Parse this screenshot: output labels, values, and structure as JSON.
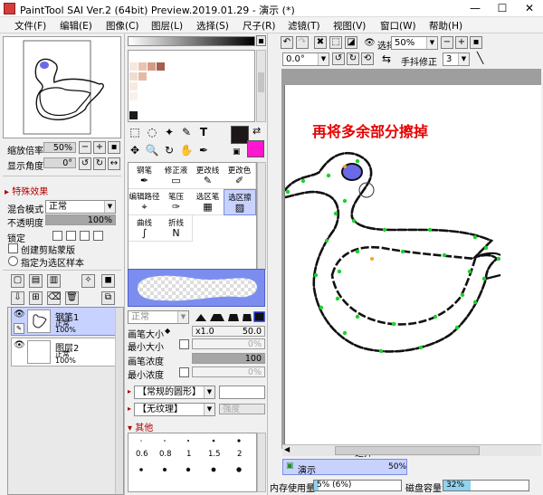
{
  "window": {
    "title": "PaintTool SAI Ver.2 (64bit) Preview.2019.01.29 - 演示 (*)",
    "min": "—",
    "max": "☐",
    "close": "✕"
  },
  "menu": [
    {
      "label": "文件(F)"
    },
    {
      "label": "编辑(E)"
    },
    {
      "label": "图像(C)"
    },
    {
      "label": "图层(L)"
    },
    {
      "label": "选择(S)"
    },
    {
      "label": "尺子(R)"
    },
    {
      "label": "滤镜(T)"
    },
    {
      "label": "视图(V)"
    },
    {
      "label": "窗口(W)"
    },
    {
      "label": "帮助(H)"
    }
  ],
  "navigator": {
    "zoom_label": "缩放倍率",
    "zoom_value": "50%",
    "angle_label": "显示角度",
    "angle_value": "0°"
  },
  "layer_panel": {
    "section_title": "特殊效果",
    "blend_label": "混合模式",
    "blend_value": "正常",
    "opacity_label": "不透明度",
    "opacity_value": "100%",
    "opacity_level": 1.0,
    "lock_label": "锁定",
    "clip_label": "创建剪贴蒙版",
    "sample_label": "指定为选区样本",
    "layers": [
      {
        "name": "钢笔1",
        "mode": "正常",
        "pct": "100%",
        "selected": true
      },
      {
        "name": "图层2",
        "mode": "正常",
        "pct": "100%",
        "selected": false
      }
    ]
  },
  "palette_colors": [
    "#f4e8e0",
    "#e8c4b0",
    "#d49b86",
    "#a45f4b",
    "#f2dcd2",
    "#e6b9a6",
    "#f6ebe4",
    "#f9f1ec",
    "#ffffff",
    "#1b1b1b"
  ],
  "colors": {
    "primary": "#1e1719",
    "secondary": "#ff17d0",
    "selection": "#c8d2ff",
    "stroke_green": "#19d32a"
  },
  "tools": [
    {
      "name": "select-rect-icon",
      "glyph": "⬚"
    },
    {
      "name": "lasso-icon",
      "glyph": "◌"
    },
    {
      "name": "magic-wand-icon",
      "glyph": "✦"
    },
    {
      "name": "pen-select-icon",
      "glyph": "✎"
    },
    {
      "name": "text-icon",
      "glyph": "T"
    },
    {
      "name": "move-icon",
      "glyph": "✥"
    },
    {
      "name": "zoom-icon",
      "glyph": "🔍"
    },
    {
      "name": "rotate-icon",
      "glyph": "↻"
    },
    {
      "name": "hand-icon",
      "glyph": "✋"
    },
    {
      "name": "eyedropper-icon",
      "glyph": "✒"
    }
  ],
  "brushes": [
    {
      "label": "钢笔",
      "icon": "✒"
    },
    {
      "label": "修正液",
      "icon": "▭"
    },
    {
      "label": "更改线",
      "icon": "✎"
    },
    {
      "label": "更改色",
      "icon": "✐"
    },
    {
      "label": "编辑路径",
      "icon": "⌖"
    },
    {
      "label": "笔压",
      "icon": "✑"
    },
    {
      "label": "选区笔",
      "icon": "▦"
    },
    {
      "label": "选区擦",
      "icon": "▨"
    },
    {
      "label": "曲线",
      "icon": "∫"
    },
    {
      "label": "折线",
      "icon": "N"
    }
  ],
  "brush_settings": {
    "mode_value": "正常",
    "size_label": "画笔大小",
    "size_mult": "x1.0",
    "size_value": "50.0",
    "min_size_label": "最小大小",
    "min_size_value": "0%",
    "density_label": "画笔浓度",
    "density_value": "100",
    "min_density_label": "最小浓度",
    "min_density_value": "0%",
    "shape_value": "【常规的圆形】",
    "texture_value": "【无纹理】",
    "texture_strength_label": "强度",
    "other_label": "其他",
    "dot_sizes": [
      "0.6",
      "0.8",
      "1",
      "1.5",
      "2"
    ]
  },
  "canvas_toolbar": {
    "select_label": "选择",
    "zoom_value": "50%",
    "angle_value": "0.0°",
    "stabilizer_label": "手抖修正",
    "stabilizer_value": "3"
  },
  "canvas": {
    "annotation": "再将多余部分擦掉",
    "hscroll_label": "选择"
  },
  "document_tab": {
    "name": "演示",
    "zoom": "50%"
  },
  "status": {
    "memory_label": "内存使用量",
    "memory_text": "5% (6%)",
    "memory_level": 0.05,
    "disk_label": "磁盘容量",
    "disk_text": "32%",
    "disk_level": 0.32
  }
}
